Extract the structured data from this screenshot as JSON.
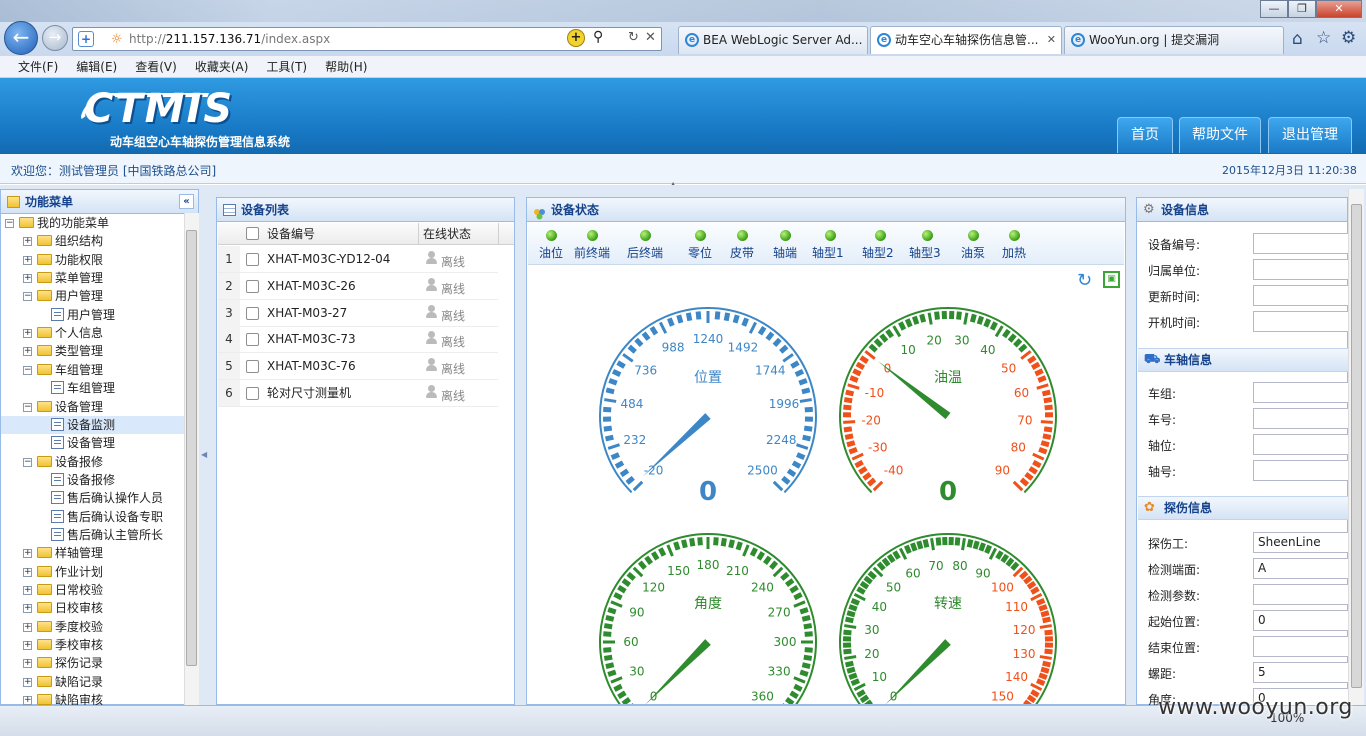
{
  "browser": {
    "address": {
      "prefix": "http://",
      "host": "211.157.136.71",
      "path": "/index.aspx"
    },
    "tabs": [
      {
        "label": "BEA WebLogic Server Ad..."
      },
      {
        "label": "动车空心车轴探伤信息管..."
      },
      {
        "label": "WooYun.org | 提交漏洞"
      }
    ],
    "menu": [
      "文件(F)",
      "编辑(E)",
      "查看(V)",
      "收藏夹(A)",
      "工具(T)",
      "帮助(H)"
    ],
    "zoom": "100%",
    "watermark": "www.wooyun.org"
  },
  "app": {
    "logo": "CTMIS",
    "subtitle": "动车组空心车轴探伤管理信息系统",
    "nav": [
      "首页",
      "帮助文件",
      "退出管理"
    ],
    "welcome": "欢迎您：测试管理员 [中国铁路总公司]",
    "datetime": "2015年12月3日 11:20:38"
  },
  "sidebar": {
    "title": "功能菜单",
    "items": [
      {
        "label": "我的功能菜单"
      },
      {
        "label": "组织结构"
      },
      {
        "label": "功能权限"
      },
      {
        "label": "菜单管理"
      },
      {
        "label": "用户管理"
      },
      {
        "label": "用户管理"
      },
      {
        "label": "个人信息"
      },
      {
        "label": "类型管理"
      },
      {
        "label": "车组管理"
      },
      {
        "label": "车组管理"
      },
      {
        "label": "设备管理"
      },
      {
        "label": "设备监测"
      },
      {
        "label": "设备管理"
      },
      {
        "label": "设备报修"
      },
      {
        "label": "设备报修"
      },
      {
        "label": "售后确认操作人员"
      },
      {
        "label": "售后确认设备专职"
      },
      {
        "label": "售后确认主管所长"
      },
      {
        "label": "样轴管理"
      },
      {
        "label": "作业计划"
      },
      {
        "label": "日常校验"
      },
      {
        "label": "日校审核"
      },
      {
        "label": "季度校验"
      },
      {
        "label": "季校审核"
      },
      {
        "label": "探伤记录"
      },
      {
        "label": "缺陷记录"
      },
      {
        "label": "缺陷审核"
      }
    ]
  },
  "device_list": {
    "title": "设备列表",
    "columns": [
      "设备编号",
      "在线状态"
    ],
    "rows": [
      {
        "num": "1",
        "code": "XHAT-M03C-YD12-04",
        "status": "离线"
      },
      {
        "num": "2",
        "code": "XHAT-M03C-26",
        "status": "离线"
      },
      {
        "num": "3",
        "code": "XHAT-M03-27",
        "status": "离线"
      },
      {
        "num": "4",
        "code": "XHAT-M03C-73",
        "status": "离线"
      },
      {
        "num": "5",
        "code": "XHAT-M03C-76",
        "status": "离线"
      },
      {
        "num": "6",
        "code": "轮对尺寸测量机",
        "status": "离线"
      }
    ]
  },
  "device_status": {
    "title": "设备状态",
    "indicators": [
      "油位",
      "前终端",
      "后终端",
      "零位",
      "皮带",
      "轴端",
      "轴型1",
      "轴型2",
      "轴型3",
      "油泵",
      "加热"
    ],
    "gauges": [
      {
        "label": "位置",
        "value": "0",
        "ticks": [
          "-20",
          "232",
          "484",
          "736",
          "988",
          "1240",
          "1492",
          "1744",
          "1996",
          "2248",
          "2500"
        ],
        "color": "#3d87c6",
        "hot_from": 11
      },
      {
        "label": "油温",
        "value": "0",
        "ticks": [
          "-40",
          "-30",
          "-20",
          "-10",
          "0",
          "10",
          "20",
          "30",
          "40",
          "50",
          "60",
          "70",
          "80",
          "90"
        ],
        "color": "#2e8b2e",
        "cold_until": 4,
        "hot_from": 9
      },
      {
        "label": "角度",
        "value": "0",
        "ticks": [
          "0",
          "30",
          "60",
          "90",
          "120",
          "150",
          "180",
          "210",
          "240",
          "270",
          "300",
          "330",
          "360"
        ],
        "color": "#2e8b2e",
        "hot_from": 13
      },
      {
        "label": "转速",
        "value": "0",
        "ticks": [
          "0",
          "10",
          "20",
          "30",
          "40",
          "50",
          "60",
          "70",
          "80",
          "90",
          "100",
          "110",
          "120",
          "130",
          "140",
          "150"
        ],
        "color": "#2e8b2e",
        "hot_from": 10
      }
    ]
  },
  "device_info": {
    "title": "设备信息",
    "fields": [
      {
        "label": "设备编号:",
        "value": ""
      },
      {
        "label": "归属单位:",
        "value": ""
      },
      {
        "label": "更新时间:",
        "value": ""
      },
      {
        "label": "开机时间:",
        "value": ""
      }
    ]
  },
  "axle_info": {
    "title": "车轴信息",
    "fields": [
      {
        "label": "车组:",
        "value": ""
      },
      {
        "label": "车号:",
        "value": ""
      },
      {
        "label": "轴位:",
        "value": ""
      },
      {
        "label": "轴号:",
        "value": ""
      }
    ]
  },
  "flaw_info": {
    "title": "探伤信息",
    "fields": [
      {
        "label": "探伤工:",
        "value": "SheenLine"
      },
      {
        "label": "检测端面:",
        "value": "A"
      },
      {
        "label": "检测参数:",
        "value": ""
      },
      {
        "label": "起始位置:",
        "value": "0"
      },
      {
        "label": "结束位置:",
        "value": ""
      },
      {
        "label": "螺距:",
        "value": "5"
      },
      {
        "label": "角度:",
        "value": "0"
      }
    ]
  }
}
